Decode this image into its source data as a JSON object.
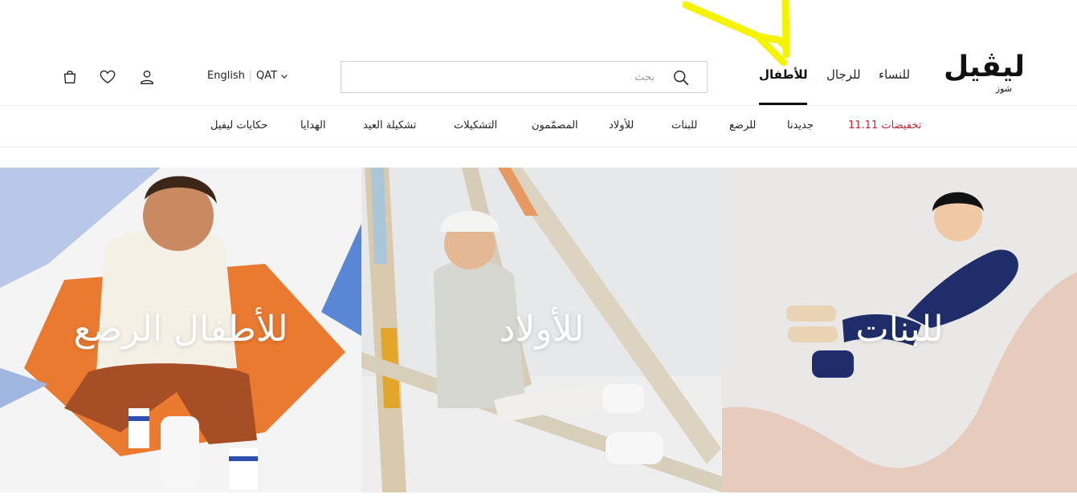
{
  "brand": {
    "logo_text": "ليڤيل",
    "logo_sub": "شوز"
  },
  "header": {
    "gender_nav": [
      {
        "label": "للنساء"
      },
      {
        "label": "للرجال"
      },
      {
        "label": "للأطفال",
        "active": true
      }
    ],
    "search": {
      "placeholder": "بحث",
      "value": ""
    },
    "country": "QAT",
    "language": "English",
    "icons": [
      "user-icon",
      "heart-icon",
      "bag-icon",
      "search-icon",
      "chevron-down-icon"
    ]
  },
  "category_nav": [
    {
      "label": "تخفيضات 11.11",
      "sale": true
    },
    {
      "label": "جديدنا"
    },
    {
      "label": "للرضع"
    },
    {
      "label": "للبنات"
    },
    {
      "label": "للأولاد"
    },
    {
      "label": "المصمّمون"
    },
    {
      "label": "التشكيلات"
    },
    {
      "label": "تشكيلة العيد"
    },
    {
      "label": "الهدايا"
    },
    {
      "label": "حكايات ليفيل"
    }
  ],
  "hero_tiles": [
    {
      "label": "للبنات"
    },
    {
      "label": "للأولاد"
    },
    {
      "label": "للأطفال الرضع"
    }
  ],
  "colors": {
    "sale": "#c2243a",
    "annotation": "#f4f400",
    "text": "#222222"
  }
}
